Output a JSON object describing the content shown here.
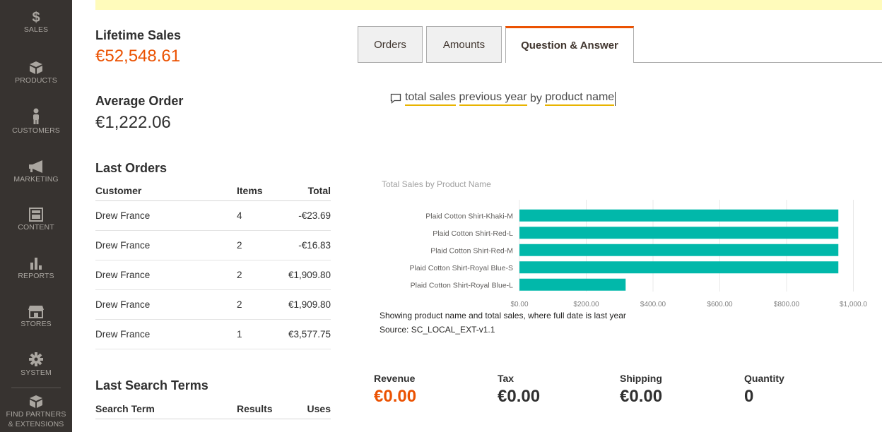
{
  "colors": {
    "sidebar_bg": "#373330",
    "accent_orange": "#eb5202",
    "bar_teal": "#01b8aa",
    "notice_yellow": "#fffbbb",
    "underline_gold": "#e8b400"
  },
  "nav": [
    {
      "label": "SALES",
      "icon": "dollar-icon"
    },
    {
      "label": "PRODUCTS",
      "icon": "box-icon"
    },
    {
      "label": "CUSTOMERS",
      "icon": "person-icon"
    },
    {
      "label": "MARKETING",
      "icon": "megaphone-icon"
    },
    {
      "label": "CONTENT",
      "icon": "layout-icon"
    },
    {
      "label": "REPORTS",
      "icon": "bar-chart-icon"
    },
    {
      "label": "STORES",
      "icon": "storefront-icon"
    },
    {
      "label": "SYSTEM",
      "icon": "gear-icon"
    },
    {
      "label": "FIND PARTNERS",
      "label2": "& EXTENSIONS",
      "icon": "partners-box-icon"
    }
  ],
  "lifetime_sales": {
    "title": "Lifetime Sales",
    "value": "€52,548.61"
  },
  "average_order": {
    "title": "Average Order",
    "value": "€1,222.06"
  },
  "last_orders": {
    "title": "Last Orders",
    "headers": [
      "Customer",
      "Items",
      "Total"
    ],
    "rows": [
      {
        "customer": "Drew France",
        "items": "4",
        "total": "-€23.69"
      },
      {
        "customer": "Drew France",
        "items": "2",
        "total": "-€16.83"
      },
      {
        "customer": "Drew France",
        "items": "2",
        "total": "€1,909.80"
      },
      {
        "customer": "Drew France",
        "items": "2",
        "total": "€1,909.80"
      },
      {
        "customer": "Drew France",
        "items": "1",
        "total": "€3,577.75"
      }
    ]
  },
  "last_search_terms": {
    "title": "Last Search Terms",
    "headers": [
      "Search Term",
      "Results",
      "Uses"
    ]
  },
  "tabs": [
    {
      "label": "Orders",
      "active": false
    },
    {
      "label": "Amounts",
      "active": false
    },
    {
      "label": "Question & Answer",
      "active": true
    }
  ],
  "qa": {
    "query_terms": [
      "total sales",
      "previous year",
      "by",
      "product name"
    ],
    "description": "Showing product name and total sales, where full date is last year",
    "source": "Source: SC_LOCAL_EXT-v1.1"
  },
  "chart_data": {
    "type": "bar",
    "orientation": "horizontal",
    "title": "Total Sales by Product Name",
    "categories": [
      "Plaid Cotton Shirt-Khaki-M",
      "Plaid Cotton Shirt-Red-L",
      "Plaid Cotton Shirt-Red-M",
      "Plaid Cotton Shirt-Royal Blue-S",
      "Plaid Cotton Shirt-Royal Blue-L"
    ],
    "values": [
      955,
      955,
      955,
      955,
      318
    ],
    "xlim": [
      0,
      1000
    ],
    "tick_labels": [
      "$0.00",
      "$200.00",
      "$400.00",
      "$600.00",
      "$800.00",
      "$1,000.0"
    ],
    "grid": true,
    "color": "#01b8aa"
  },
  "totals": [
    {
      "label": "Revenue",
      "value": "€0.00",
      "color": "#eb5202"
    },
    {
      "label": "Tax",
      "value": "€0.00",
      "color": "#303030"
    },
    {
      "label": "Shipping",
      "value": "€0.00",
      "color": "#303030"
    },
    {
      "label": "Quantity",
      "value": "0",
      "color": "#303030"
    }
  ]
}
